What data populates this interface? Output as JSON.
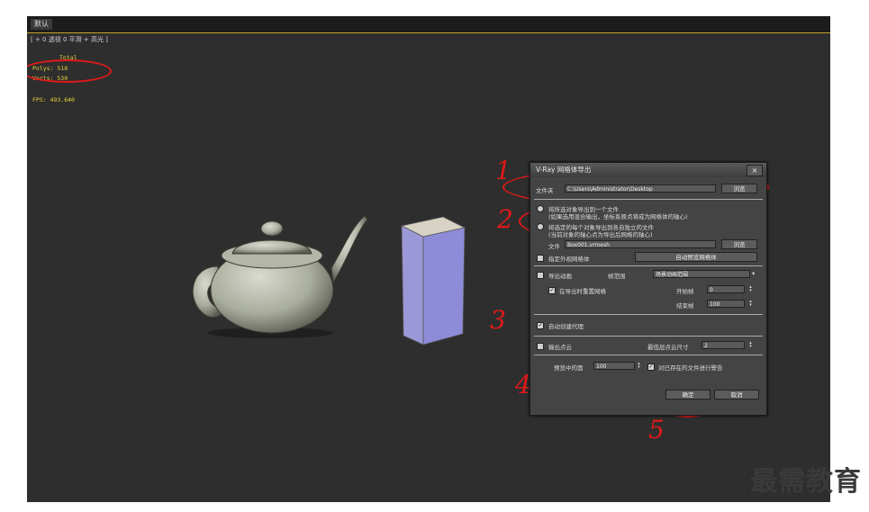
{
  "viewport": {
    "tabs": [
      "默认"
    ],
    "label": "[ + 0 透视 0 平滑 + 高光 ]",
    "stats": {
      "total_label": "Total",
      "polys": "Polys: 518",
      "verts": "Verts: 530",
      "fps": "FPS:   493.640"
    }
  },
  "dialog": {
    "title": "V-Ray 网格体导出",
    "close_label": "×",
    "folder_label": "文件夹",
    "folder_value": "C:\\Users\\Administrator\\Desktop",
    "browse_label": "浏览",
    "option1_line1": "将所选对象导出到一个文件",
    "option1_line2": "(如果选用混合输出，坐标系原点将成为网格体的轴心)",
    "option2_line1": "将选定的每个对象导出到各自独立的文件",
    "option2_line2": "(当前对象的轴心点为导出后网格的轴心)",
    "file_label": "文件",
    "file_value": "Box001.vrmesh",
    "browse2_label": "浏览",
    "specify_label": "指定外视网格体",
    "auto_preview_label": "自动预览网格体",
    "export_anim_label": "导出动画",
    "frame_range_label": "帧范围",
    "frame_range_value": "场景动画范围",
    "start_label": "开始帧",
    "start_value": "0",
    "end_label": "结束帧",
    "end_value": "100",
    "motion_blur_label": "在导出时重置网格",
    "auto_proxy_label": "自动创建代理",
    "export_points_label": "输出点云",
    "point_size_label": "最低层点云尺寸",
    "point_size_value": "2",
    "preview_faces_label": "预览中的面",
    "preview_faces_value": "100",
    "overwrite_label": "对已存在的文件进行警告",
    "ok_label": "确定",
    "cancel_label": "取消"
  },
  "annotations": [
    "1",
    "2",
    "3",
    "4",
    "5"
  ],
  "watermark": "最需教育"
}
